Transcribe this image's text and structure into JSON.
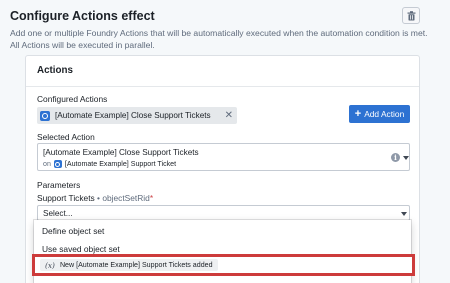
{
  "header": {
    "title": "Configure Actions effect",
    "description": "Add one or multiple Foundry Actions that will be automatically executed when the automation condition is met. All Actions will be executed in parallel."
  },
  "actions_card": {
    "title": "Actions",
    "configured_label": "Configured Actions",
    "configured_tag": "[Automate Example] Close Support Tickets",
    "add_button": "Add Action",
    "selected_label": "Selected Action",
    "selected_action": {
      "name": "[Automate Example] Close Support Tickets",
      "on_text": "on",
      "object_type": "[Automate Example] Support Ticket"
    },
    "parameters_label": "Parameters",
    "parameter": {
      "name": "Support Tickets",
      "separator": " • ",
      "id": "objectSetRid",
      "required_mark": "*"
    },
    "select_value": "Select..."
  },
  "dropdown": {
    "items": [
      "Define object set",
      "Use saved object set"
    ],
    "variable_symbol": "(x)",
    "variable_label": "New [Automate Example] Support Tickets added"
  },
  "colors": {
    "primary": "#2d72d2",
    "highlight_border": "#cd3b3b",
    "required": "#cd4246"
  },
  "icons": [
    "trash-icon",
    "object-type-icon",
    "close-icon",
    "plus-icon",
    "info-icon",
    "caret-down-icon",
    "variable-icon"
  ]
}
